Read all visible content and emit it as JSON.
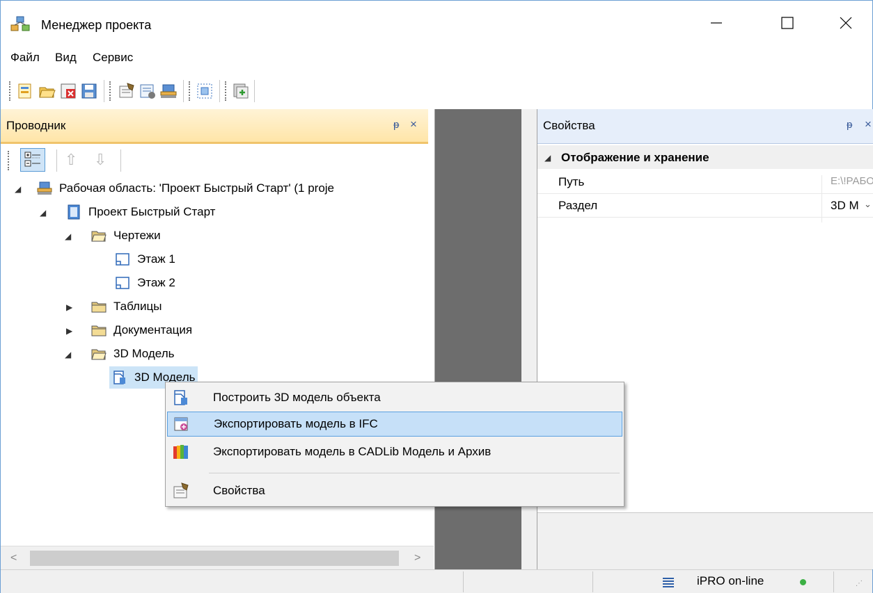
{
  "window": {
    "title": "Менеджер проекта",
    "icons": {
      "app": "network-project-icon",
      "minimize": "minimize-icon",
      "maximize": "maximize-icon",
      "close": "close-icon"
    }
  },
  "menu": [
    "Файл",
    "Вид",
    "Сервис"
  ],
  "toolbar": {
    "buttons": [
      "new-project-icon",
      "open-project-icon",
      "close-project-icon",
      "save-project-icon",
      "project-properties-icon",
      "settings-icon",
      "workspace-icon",
      "grid-icon",
      "add-icon"
    ]
  },
  "explorer": {
    "title": "Проводник",
    "pin": "ᵽ",
    "close": "×",
    "tree": [
      {
        "label": "Рабочая область: 'Проект Быстрый Старт' (1 proje",
        "icon": "workspace-icon",
        "expanded": true
      },
      {
        "label": "Проект Быстрый Старт",
        "icon": "project-icon",
        "expanded": true
      },
      {
        "label": "Чертежи",
        "icon": "open-folder-icon",
        "expanded": true
      },
      {
        "label": "Этаж 1",
        "icon": "drawing-icon"
      },
      {
        "label": "Этаж 2",
        "icon": "drawing-icon"
      },
      {
        "label": "Таблицы",
        "icon": "folder-icon",
        "expanded": false
      },
      {
        "label": "Документация",
        "icon": "folder-icon",
        "expanded": false
      },
      {
        "label": "3D Модель",
        "icon": "open-folder-icon",
        "expanded": true
      },
      {
        "label": "3D Модель",
        "icon": "model-icon",
        "selected": true
      }
    ]
  },
  "properties": {
    "title": "Свойства",
    "group": "Отображение и хранение",
    "rows": [
      {
        "name": "Путь",
        "value": "E:\\!РАБО"
      },
      {
        "name": "Раздел",
        "value": "3D М"
      }
    ]
  },
  "context_menu": [
    {
      "label": "Построить 3D модель объекта",
      "icon": "build-model-icon"
    },
    {
      "label": "Экспортировать модель в IFC",
      "icon": "export-ifc-icon",
      "highlighted": true
    },
    {
      "label": "Экспортировать модель в CADLib Модель и Архив",
      "icon": "export-cadlib-icon"
    },
    {
      "label": "Свойства",
      "icon": "properties-icon"
    }
  ],
  "status": {
    "service": "iPRO on-line",
    "colors": {
      "online": "#3cb044"
    }
  }
}
